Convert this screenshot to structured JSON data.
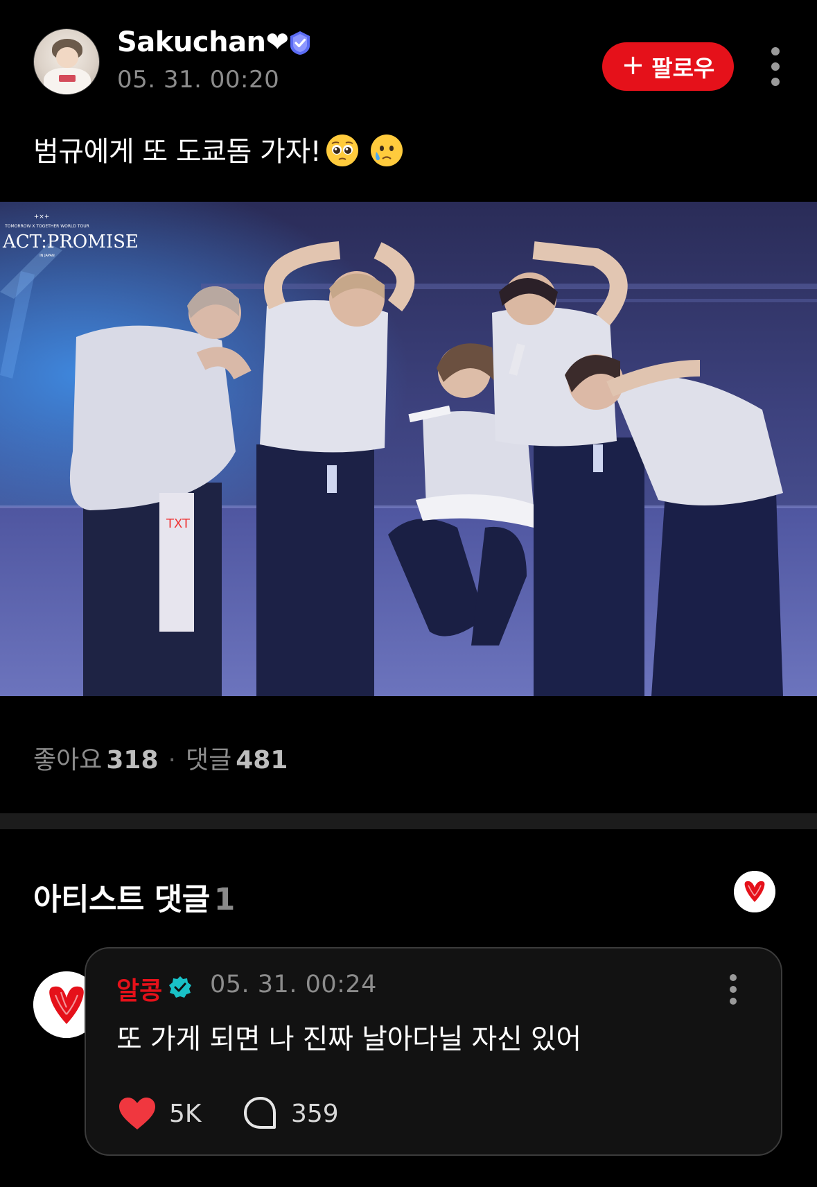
{
  "post": {
    "author": "Sakuchan❤",
    "time": "05. 31. 00:20",
    "follow_label": "팔로우",
    "text": "범규에게 또 도쿄돔 가자!",
    "emojis": [
      "pleading-face",
      "crying-face"
    ],
    "photo": {
      "tour_logo_top": "TOMORROW X TOGETHER WORLD TOUR",
      "tour_logo_main": "ACT:PROMISE",
      "tour_logo_sub": "IN JAPAN"
    },
    "stats": {
      "likes_label": "좋아요",
      "likes": "318",
      "separator": "·",
      "comments_label": "댓글",
      "comments": "481"
    }
  },
  "artist_section": {
    "title": "아티스트 댓글",
    "count": "1"
  },
  "comment": {
    "author": "알콩",
    "time": "05. 31. 00:24",
    "text": "또 가게 되면 나 진짜 날아다닐 자신 있어",
    "likes": "5K",
    "replies": "359"
  },
  "colors": {
    "accent_red": "#e5111a",
    "badge_blue": "#5b6cf5",
    "badge_teal": "#19c1c7"
  }
}
